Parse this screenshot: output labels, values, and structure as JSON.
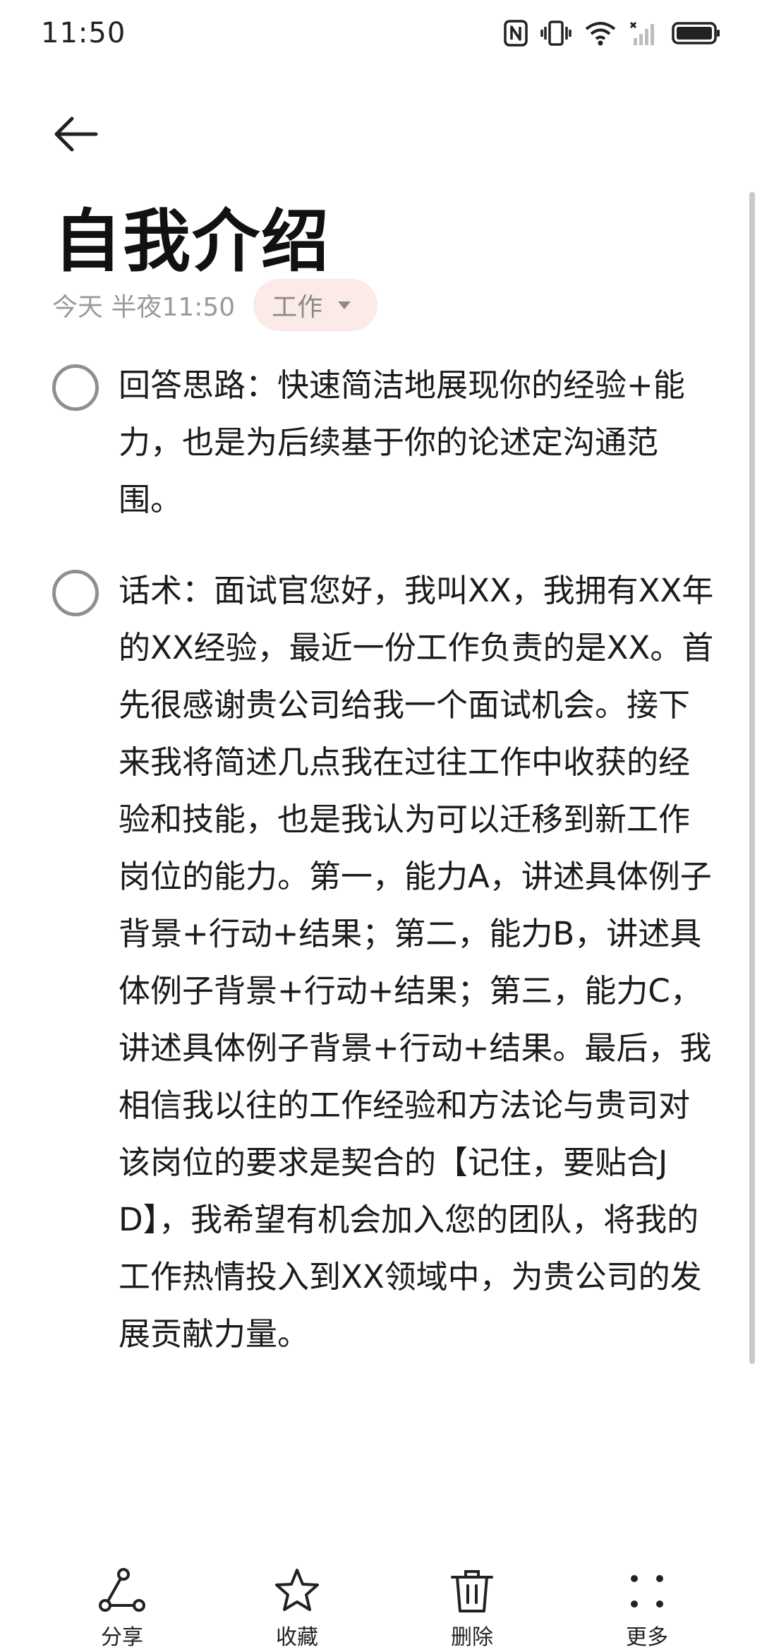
{
  "status_bar": {
    "time": "11:50",
    "icons": [
      "nfc-icon",
      "vibrate-icon",
      "wifi-icon",
      "signal-icon",
      "battery-icon"
    ]
  },
  "note": {
    "title": "自我介绍",
    "date": "今天 半夜11:50",
    "category": "工作",
    "checklist": [
      {
        "checked": false,
        "text": "回答思路：快速简洁地展现你的经验+能力，也是为后续基于你的论述定沟通范围。"
      },
      {
        "checked": false,
        "text": "话术：面试官您好，我叫XX，我拥有XX年的XX经验，最近一份工作负责的是XX。首先很感谢贵公司给我一个面试机会。接下来我将简述几点我在过往工作中收获的经验和技能，也是我认为可以迁移到新工作岗位的能力。第一，能力A，讲述具体例子背景+行动+结果；第二，能力B，讲述具体例子背景+行动+结果；第三，能力C，讲述具体例子背景+行动+结果。最后，我相信我以往的工作经验和方法论与贵司对该岗位的要求是契合的【记住，要贴合JD】，我希望有机会加入您的团队，将我的工作热情投入到XX领域中，为贵公司的发展贡献力量。"
      }
    ]
  },
  "toolbar": {
    "share_label": "分享",
    "favorite_label": "收藏",
    "delete_label": "删除",
    "more_label": "更多"
  },
  "colors": {
    "tag_bg": "#fbeae7",
    "muted_text": "#9a9a9a",
    "checkbox_border": "#8f8f8f"
  }
}
